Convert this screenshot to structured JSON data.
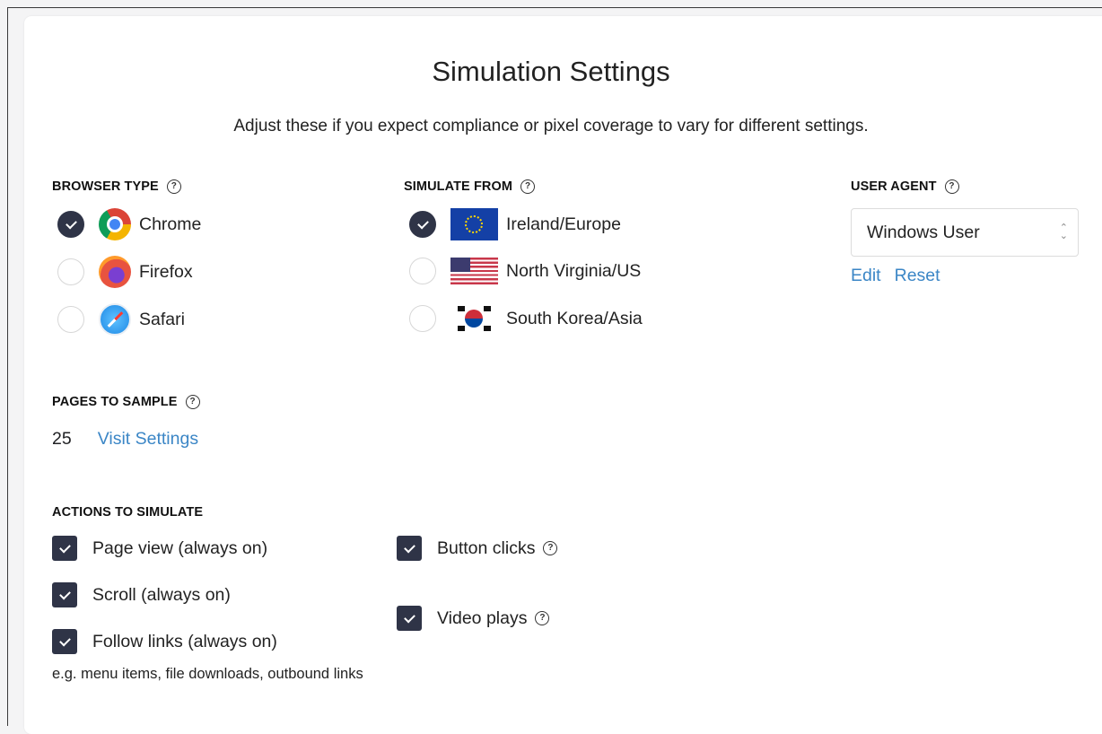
{
  "header": {
    "title": "Simulation Settings",
    "subtitle": "Adjust these if you expect compliance or pixel coverage to vary for different settings."
  },
  "browser_type": {
    "label": "BROWSER TYPE",
    "options": [
      {
        "label": "Chrome",
        "selected": true,
        "icon": "chrome-icon"
      },
      {
        "label": "Firefox",
        "selected": false,
        "icon": "firefox-icon"
      },
      {
        "label": "Safari",
        "selected": false,
        "icon": "safari-icon"
      }
    ]
  },
  "simulate_from": {
    "label": "SIMULATE FROM",
    "options": [
      {
        "label": "Ireland/Europe",
        "selected": true,
        "icon": "eu-flag-icon"
      },
      {
        "label": "North Virginia/US",
        "selected": false,
        "icon": "us-flag-icon"
      },
      {
        "label": "South Korea/Asia",
        "selected": false,
        "icon": "korea-flag-icon"
      }
    ]
  },
  "user_agent": {
    "label": "USER AGENT",
    "value": "Windows User",
    "edit_label": "Edit",
    "reset_label": "Reset"
  },
  "pages_to_sample": {
    "label": "PAGES TO SAMPLE",
    "value": "25",
    "link_label": "Visit Settings"
  },
  "actions": {
    "label": "ACTIONS TO SIMULATE",
    "items": [
      {
        "label": "Page view (always on)",
        "checked": true
      },
      {
        "label": "Scroll (always on)",
        "checked": true
      },
      {
        "label": "Follow links (always on)",
        "checked": true
      },
      {
        "label": "Button clicks",
        "checked": true
      },
      {
        "label": "Video plays",
        "checked": true
      }
    ],
    "note": "e.g. menu items, file downloads, outbound links"
  },
  "colors": {
    "accent": "#2f3447",
    "link": "#3b86c6"
  }
}
